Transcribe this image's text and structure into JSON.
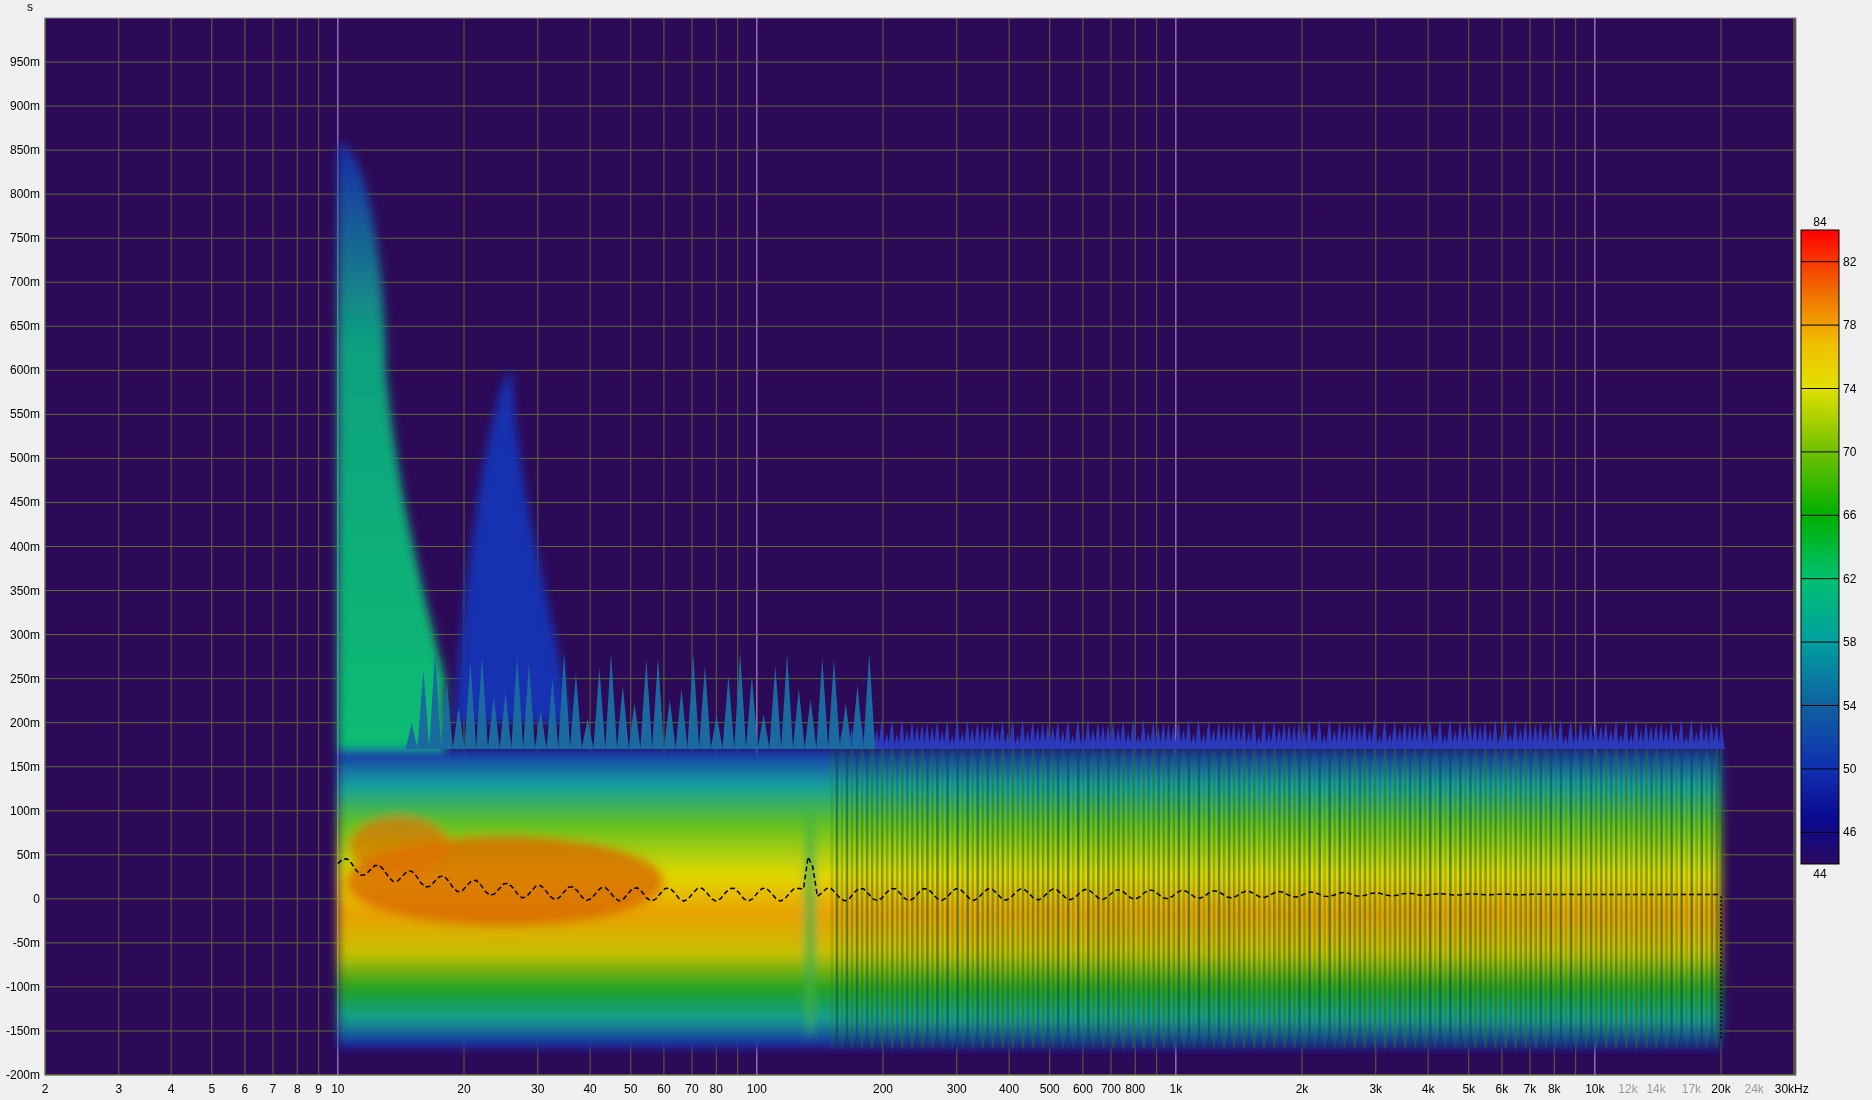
{
  "y_axis": {
    "unit": "s",
    "ticks": [
      "950m",
      "900m",
      "850m",
      "800m",
      "750m",
      "700m",
      "650m",
      "600m",
      "550m",
      "500m",
      "450m",
      "400m",
      "350m",
      "300m",
      "250m",
      "200m",
      "150m",
      "100m",
      "50m",
      "0",
      "-50m",
      "-100m",
      "-150m",
      "-200m"
    ]
  },
  "x_axis": {
    "ticks": [
      {
        "label": "2",
        "dimmed": false
      },
      {
        "label": "3",
        "dimmed": false
      },
      {
        "label": "4",
        "dimmed": false
      },
      {
        "label": "5",
        "dimmed": false
      },
      {
        "label": "6",
        "dimmed": false
      },
      {
        "label": "7",
        "dimmed": false
      },
      {
        "label": "8",
        "dimmed": false
      },
      {
        "label": "9",
        "dimmed": false
      },
      {
        "label": "10",
        "dimmed": false
      },
      {
        "label": "20",
        "dimmed": false
      },
      {
        "label": "30",
        "dimmed": false
      },
      {
        "label": "40",
        "dimmed": false
      },
      {
        "label": "50",
        "dimmed": false
      },
      {
        "label": "60",
        "dimmed": false
      },
      {
        "label": "70",
        "dimmed": false
      },
      {
        "label": "80",
        "dimmed": false
      },
      {
        "label": "100",
        "dimmed": false
      },
      {
        "label": "200",
        "dimmed": false
      },
      {
        "label": "300",
        "dimmed": false
      },
      {
        "label": "400",
        "dimmed": false
      },
      {
        "label": "500",
        "dimmed": false
      },
      {
        "label": "600",
        "dimmed": false
      },
      {
        "label": "700",
        "dimmed": false
      },
      {
        "label": "800",
        "dimmed": false
      },
      {
        "label": "1k",
        "dimmed": false
      },
      {
        "label": "2k",
        "dimmed": false
      },
      {
        "label": "3k",
        "dimmed": false
      },
      {
        "label": "4k",
        "dimmed": false
      },
      {
        "label": "5k",
        "dimmed": false
      },
      {
        "label": "6k",
        "dimmed": false
      },
      {
        "label": "7k",
        "dimmed": false
      },
      {
        "label": "8k",
        "dimmed": false
      },
      {
        "label": "10k",
        "dimmed": false
      },
      {
        "label": "12k",
        "dimmed": true
      },
      {
        "label": "14k",
        "dimmed": true
      },
      {
        "label": "17k",
        "dimmed": true
      },
      {
        "label": "20k",
        "dimmed": false
      },
      {
        "label": "24k",
        "dimmed": true
      },
      {
        "label": "30kHz",
        "dimmed": false
      }
    ]
  },
  "color_scale": {
    "ticks": [
      "84",
      "82",
      "78",
      "74",
      "70",
      "66",
      "62",
      "58",
      "54",
      "50",
      "46",
      "44"
    ]
  }
}
